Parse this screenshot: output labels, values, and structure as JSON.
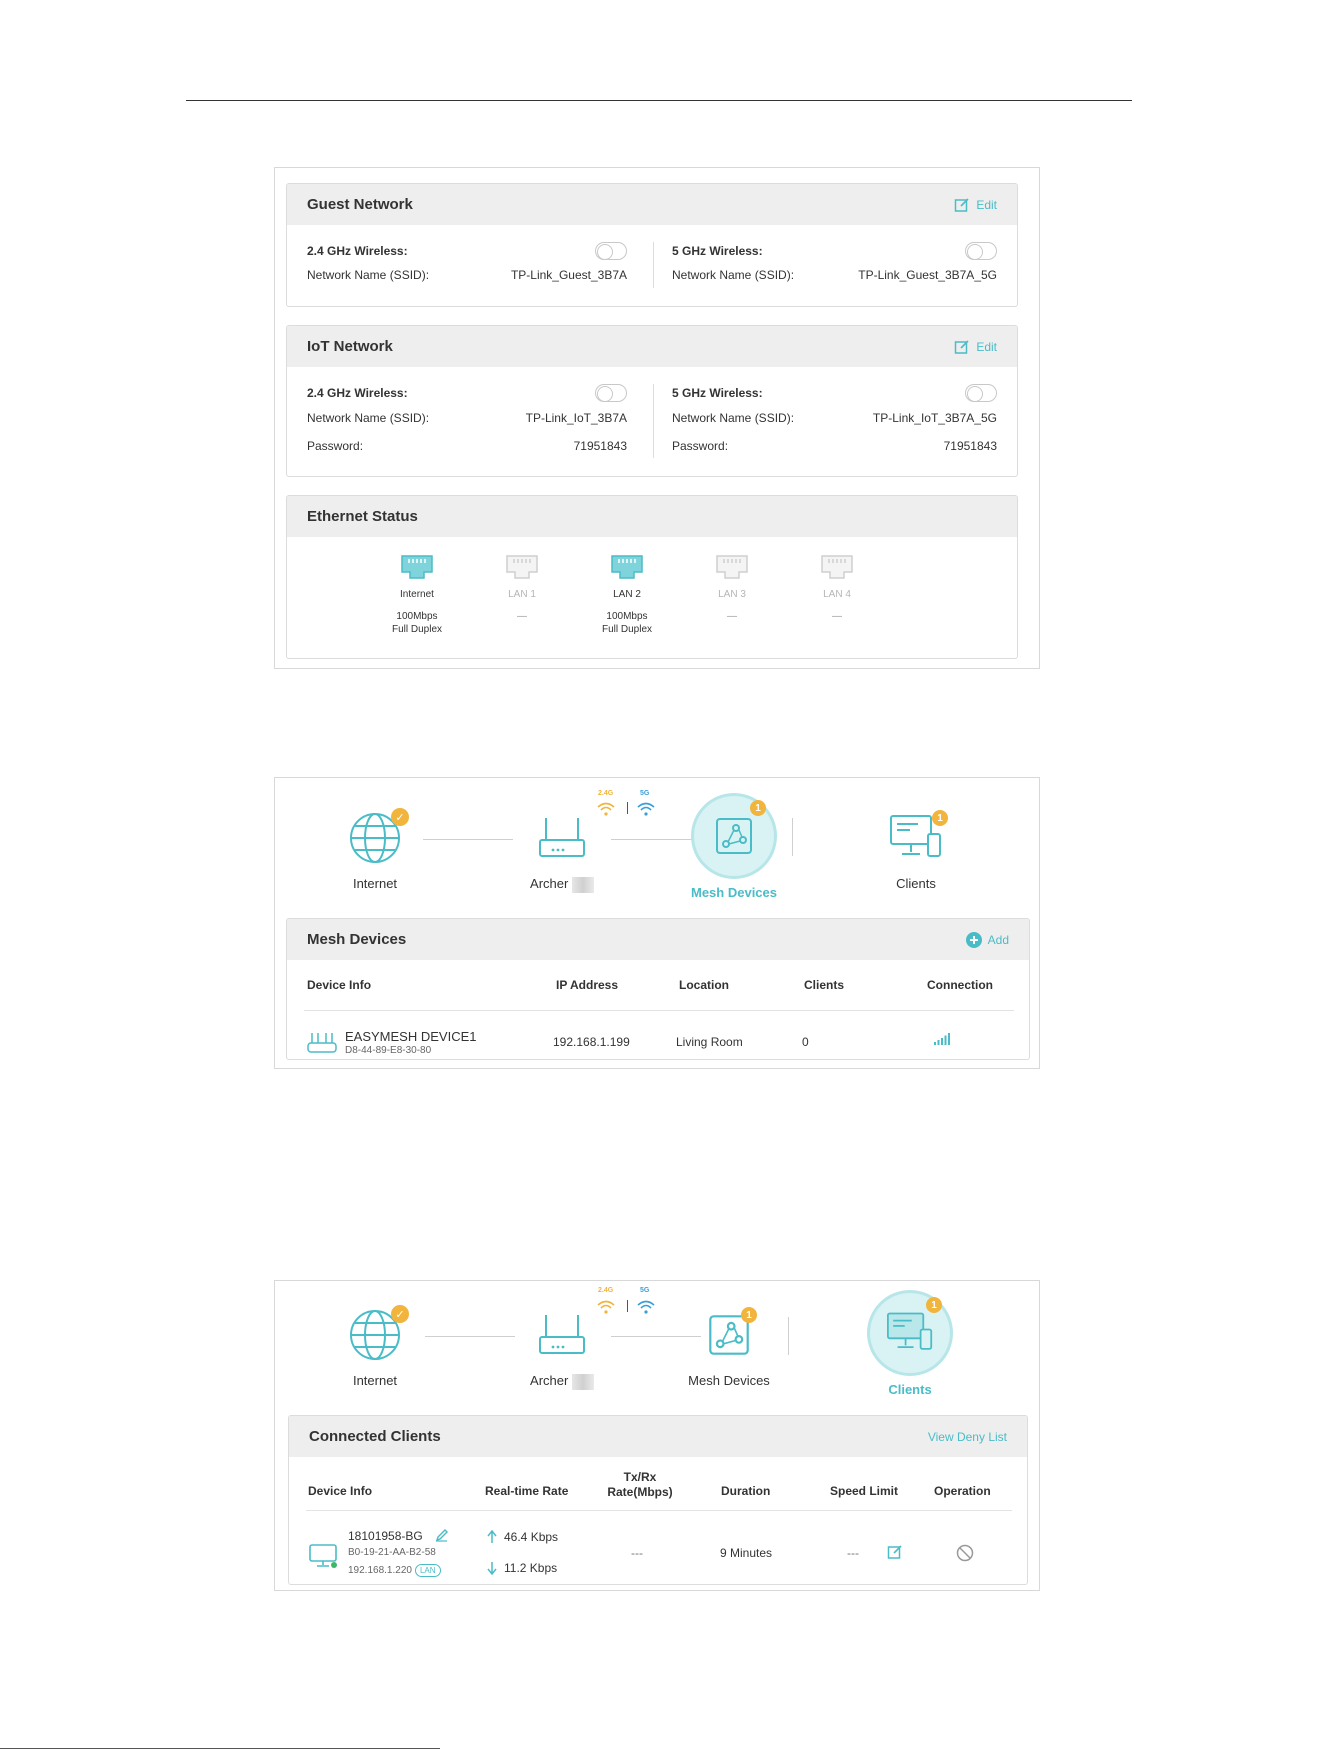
{
  "shot1": {
    "guest": {
      "title": "Guest Network",
      "edit": "Edit",
      "left": {
        "band": "2.4 GHz Wireless:",
        "ssid_label": "Network Name (SSID):",
        "ssid": "TP-Link_Guest_3B7A"
      },
      "right": {
        "band": "5 GHz Wireless:",
        "ssid_label": "Network Name (SSID):",
        "ssid": "TP-Link_Guest_3B7A_5G"
      }
    },
    "iot": {
      "title": "IoT Network",
      "edit": "Edit",
      "left": {
        "band": "2.4 GHz Wireless:",
        "ssid_label": "Network Name (SSID):",
        "ssid": "TP-Link_IoT_3B7A",
        "pw_label": "Password:",
        "pw": "71951843"
      },
      "right": {
        "band": "5 GHz Wireless:",
        "ssid_label": "Network Name (SSID):",
        "ssid": "TP-Link_IoT_3B7A_5G",
        "pw_label": "Password:",
        "pw": "71951843"
      }
    },
    "ethernet": {
      "title": "Ethernet Status",
      "ports": [
        {
          "name": "Internet",
          "line1": "100Mbps",
          "line2": "Full Duplex",
          "active": true
        },
        {
          "name": "LAN 1",
          "line1": "—",
          "line2": "",
          "active": false
        },
        {
          "name": "LAN 2",
          "line1": "100Mbps",
          "line2": "Full Duplex",
          "active": true
        },
        {
          "name": "LAN 3",
          "line1": "—",
          "line2": "",
          "active": false
        },
        {
          "name": "LAN 4",
          "line1": "—",
          "line2": "",
          "active": false
        }
      ]
    }
  },
  "topology": {
    "internet": "Internet",
    "router": "Archer",
    "mesh": "Mesh Devices",
    "clients": "Clients",
    "band24": "2.4G",
    "band5": "5G",
    "mesh_count": "1",
    "clients_count": "1"
  },
  "shot2": {
    "title": "Mesh Devices",
    "add": "Add",
    "headers": [
      "Device Info",
      "IP Address",
      "Location",
      "Clients",
      "Connection"
    ],
    "row": {
      "name": "EASYMESH DEVICE1",
      "mac": "D8-44-89-E8-30-80",
      "ip": "192.168.1.199",
      "location": "Living Room",
      "clients": "0"
    }
  },
  "shot3": {
    "title": "Connected Clients",
    "deny": "View Deny List",
    "headers": {
      "device": "Device Info",
      "rate": "Real-time Rate",
      "txrx1": "Tx/Rx",
      "txrx2": "Rate(Mbps)",
      "duration": "Duration",
      "speed": "Speed Limit",
      "op": "Operation"
    },
    "row": {
      "name": "18101958-BG",
      "mac": "B0-19-21-AA-B2-58",
      "ip": "192.168.1.220",
      "conn": "LAN",
      "up": "46.4 Kbps",
      "down": "11.2 Kbps",
      "txrx": "---",
      "duration": "9 Minutes",
      "speed": "---"
    }
  },
  "colors": {
    "accent": "#4abcc7",
    "badge": "#f1b43c",
    "band24": "#f1b43c",
    "band5": "#3a9fd8"
  }
}
